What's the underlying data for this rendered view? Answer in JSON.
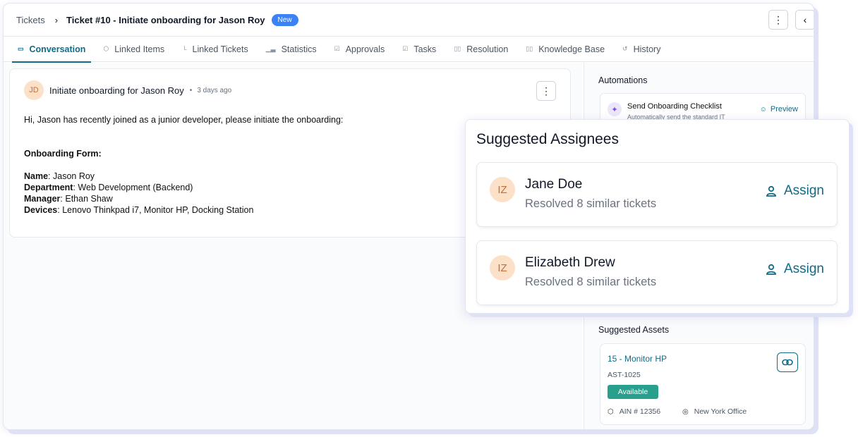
{
  "header": {
    "breadcrumb_root": "Tickets",
    "ticket_title": "Ticket #10 - Initiate onboarding for Jason Roy",
    "status_badge": "New"
  },
  "tabs": [
    {
      "label": "Conversation",
      "icon": "chat-icon",
      "active": true
    },
    {
      "label": "Linked Items",
      "icon": "cube-icon"
    },
    {
      "label": "Linked Tickets",
      "icon": "tree-icon"
    },
    {
      "label": "Statistics",
      "icon": "bar-chart-icon"
    },
    {
      "label": "Approvals",
      "icon": "check-square-icon"
    },
    {
      "label": "Tasks",
      "icon": "checkbox-icon"
    },
    {
      "label": "Resolution",
      "icon": "book-icon"
    },
    {
      "label": "Knowledge Base",
      "icon": "book-open-icon"
    },
    {
      "label": "History",
      "icon": "history-icon"
    }
  ],
  "message": {
    "avatar_initials": "JD",
    "title": "Initiate onboarding for Jason Roy",
    "time": "3 days ago",
    "intro": "Hi, Jason has recently joined as a junior developer, please initiate the onboarding:",
    "form_heading": "Onboarding Form:",
    "fields": [
      {
        "label": "Name",
        "value": ": Jason Roy"
      },
      {
        "label": "Department",
        "value": ": Web Development (Backend)"
      },
      {
        "label": "Manager",
        "value": ": Ethan Shaw"
      },
      {
        "label": "Devices",
        "value": ": Lenovo Thinkpad i7, Monitor HP, Docking Station"
      }
    ]
  },
  "automations": {
    "title": "Automations",
    "item_name": "Send Onboarding Checklist",
    "item_desc": "Automatically send the standard IT",
    "preview_label": "Preview"
  },
  "suggested_assignees": {
    "title": "Suggested Assignees",
    "items": [
      {
        "initials": "IZ",
        "name": "Jane Doe",
        "resolved": "Resolved 8 similar tickets",
        "action": "Assign"
      },
      {
        "initials": "IZ",
        "name": "Elizabeth Drew",
        "resolved": "Resolved 8 similar tickets",
        "action": "Assign"
      }
    ]
  },
  "suggested_assets": {
    "title": "Suggested Assets",
    "name": "15 - Monitor HP",
    "asset_id": "AST-1025",
    "status": "Available",
    "ain": "AIN # 12356",
    "location": "New York Office"
  },
  "colors": {
    "accent": "#0f6b86",
    "badge_blue": "#3b82f6",
    "available_green": "#27a08d",
    "avatar_peach": "#fde0c8"
  }
}
